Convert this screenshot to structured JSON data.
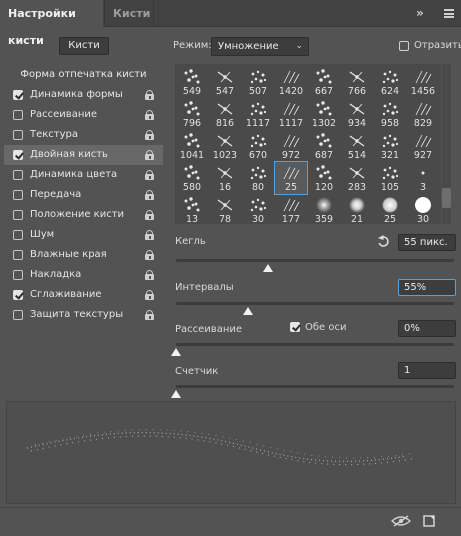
{
  "tabs": [
    {
      "label": "Настройки кисти",
      "active": true
    },
    {
      "label": "Кисти",
      "active": false
    }
  ],
  "panel_collapse_glyph": "»",
  "presets_button": "Кисти",
  "mode": {
    "label": "Режим:",
    "value": "Умножение"
  },
  "flip": {
    "label": "Отразить",
    "checked": false
  },
  "options": {
    "header": "Форма отпечатка кисти",
    "items": [
      {
        "label": "Динамика формы",
        "checked": true,
        "selected": false
      },
      {
        "label": "Рассеивание",
        "checked": false,
        "selected": false
      },
      {
        "label": "Текстура",
        "checked": false,
        "selected": false
      },
      {
        "label": "Двойная кисть",
        "checked": true,
        "selected": true
      },
      {
        "label": "Динамика цвета",
        "checked": false,
        "selected": false
      },
      {
        "label": "Передача",
        "checked": false,
        "selected": false
      },
      {
        "label": "Положение кисти",
        "checked": false,
        "selected": false
      },
      {
        "label": "Шум",
        "checked": false,
        "selected": false
      },
      {
        "label": "Влажные края",
        "checked": false,
        "selected": false
      },
      {
        "label": "Накладка",
        "checked": false,
        "selected": false
      },
      {
        "label": "Сглаживание",
        "checked": true,
        "selected": false
      },
      {
        "label": "Защита текстуры",
        "checked": false,
        "selected": false
      }
    ]
  },
  "brush_tips": [
    {
      "size": "549"
    },
    {
      "size": "547"
    },
    {
      "size": "507"
    },
    {
      "size": "1420"
    },
    {
      "size": "667"
    },
    {
      "size": "766"
    },
    {
      "size": "624"
    },
    {
      "size": "1456"
    },
    {
      "size": "796"
    },
    {
      "size": "816"
    },
    {
      "size": "1117"
    },
    {
      "size": "1117"
    },
    {
      "size": "1302"
    },
    {
      "size": "934"
    },
    {
      "size": "958"
    },
    {
      "size": "829"
    },
    {
      "size": "1041"
    },
    {
      "size": "1023"
    },
    {
      "size": "670"
    },
    {
      "size": "972"
    },
    {
      "size": "687"
    },
    {
      "size": "514"
    },
    {
      "size": "321"
    },
    {
      "size": "927"
    },
    {
      "size": "580"
    },
    {
      "size": "16"
    },
    {
      "size": "80"
    },
    {
      "size": "25",
      "selected": true
    },
    {
      "size": "120"
    },
    {
      "size": "283"
    },
    {
      "size": "105"
    },
    {
      "size": "3"
    },
    {
      "size": "13"
    },
    {
      "size": "78"
    },
    {
      "size": "30"
    },
    {
      "size": "177"
    },
    {
      "size": "359"
    },
    {
      "size": "21"
    },
    {
      "size": "25"
    },
    {
      "size": "30"
    }
  ],
  "size": {
    "label": "Кегль",
    "value": "55 пикс.",
    "level": 0.33
  },
  "spacing": {
    "label": "Интервалы",
    "value": "55%",
    "level": 0.26
  },
  "scatter": {
    "label": "Рассеивание",
    "both_axes_label": "Обе оси",
    "both_axes_checked": true,
    "value": "0%",
    "level": 0.0
  },
  "count": {
    "label": "Счетчик",
    "value": "1",
    "level": 0.0
  },
  "colors": {
    "panel": "#535353",
    "tabbar": "#424242",
    "selected_row": "#686868",
    "accent": "#5aa0d8"
  },
  "icons": {
    "reset": "reset-icon",
    "eye": "eye-icon",
    "new_preset": "new-preset-icon",
    "menu": "panel-menu-icon"
  }
}
